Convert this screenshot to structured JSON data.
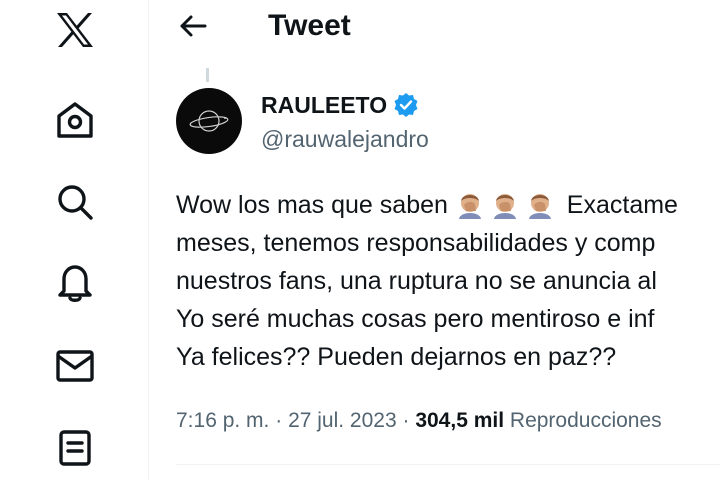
{
  "nav": {
    "items": [
      {
        "icon": "x-logo-icon"
      },
      {
        "icon": "home-icon"
      },
      {
        "icon": "search-icon"
      },
      {
        "icon": "bell-icon"
      },
      {
        "icon": "mail-icon"
      },
      {
        "icon": "list-icon"
      }
    ]
  },
  "header": {
    "title": "Tweet",
    "back_icon": "arrow-left-icon"
  },
  "tweet": {
    "author": {
      "display_name": "RAULEETO",
      "handle": "@rauwalejandro",
      "verified": true
    },
    "text": {
      "line1_before": "Wow los mas que saben ",
      "line1_emoji": "face-palm-emoji",
      "line1_after": " Exactame",
      "line2": "meses, tenemos responsabilidades y comp",
      "line3": "nuestros fans, una ruptura no se anuncia al",
      "line4": "Yo seré muchas cosas pero mentiroso e inf",
      "line5": "Ya felices?? Pueden dejarnos en paz??"
    },
    "time": "7:16 p. m.",
    "sep1": " · ",
    "date": "27 jul. 2023",
    "sep2": " · ",
    "views_count": "304,5 mil",
    "views_label": " Reproducciones"
  },
  "colors": {
    "text": "#0f1419",
    "secondary": "#536471",
    "verified": "#1d9bf0",
    "border": "#eff3f4"
  }
}
